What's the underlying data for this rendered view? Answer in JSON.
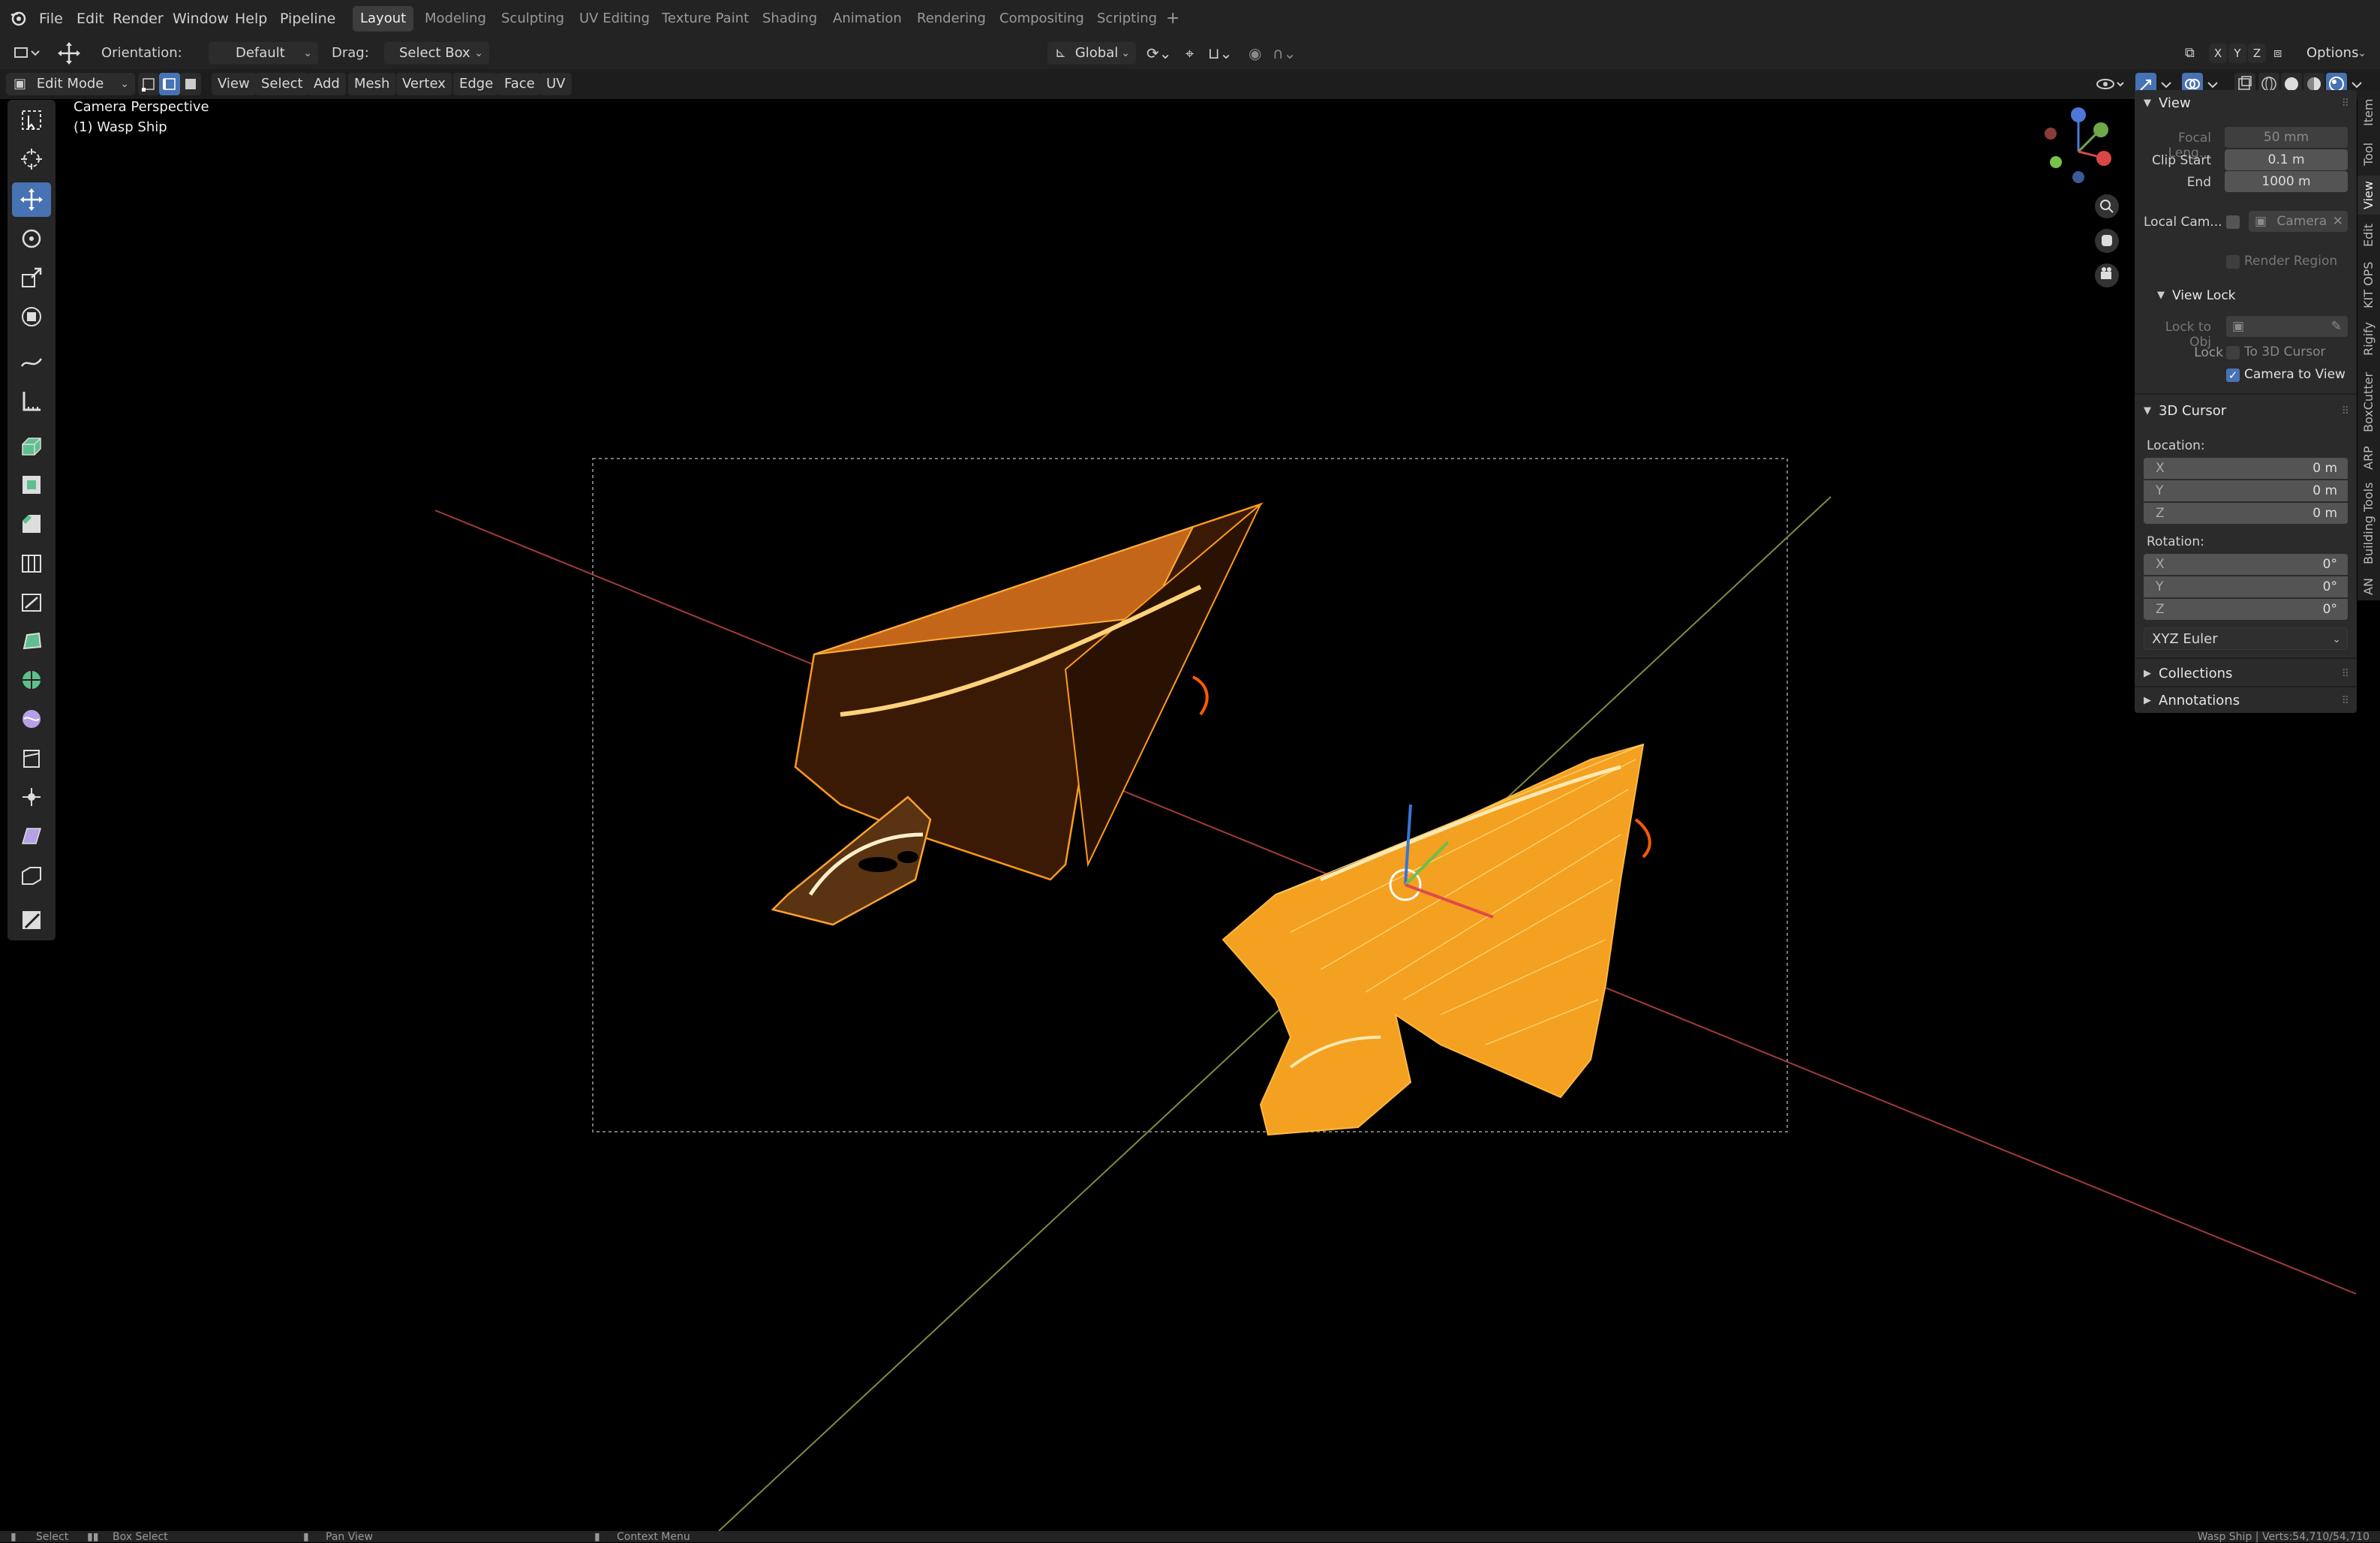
{
  "menubar": {
    "items": [
      "File",
      "Edit",
      "Render",
      "Window",
      "Help",
      "Pipeline"
    ],
    "workspaces": [
      {
        "label": "Layout",
        "active": true
      },
      {
        "label": "Modeling",
        "active": false
      },
      {
        "label": "Sculpting",
        "active": false
      },
      {
        "label": "UV Editing",
        "active": false
      },
      {
        "label": "Texture Paint",
        "active": false
      },
      {
        "label": "Shading",
        "active": false
      },
      {
        "label": "Animation",
        "active": false
      },
      {
        "label": "Rendering",
        "active": false
      },
      {
        "label": "Compositing",
        "active": false
      },
      {
        "label": "Scripting",
        "active": false
      }
    ],
    "add_tab": "+"
  },
  "toolbar": {
    "orientation_label": "Orientation:",
    "orientation_value": "Default",
    "drag_label": "Drag:",
    "drag_value": "Select Box",
    "transform_orientation": "Global",
    "axis_x": "X",
    "axis_y": "Y",
    "axis_z": "Z",
    "options": "Options"
  },
  "viewport_header": {
    "mode": "Edit Mode",
    "menus": [
      "View",
      "Select",
      "Add",
      "Mesh",
      "Vertex",
      "Edge",
      "Face",
      "UV"
    ]
  },
  "viewport": {
    "camera_label": "Camera Perspective",
    "object_label": "(1) Wasp Ship"
  },
  "sidebar": {
    "view_panel": {
      "title": "View",
      "focal_length_label": "Focal Leng...",
      "focal_length_value": "50 mm",
      "clip_start_label": "Clip Start",
      "clip_start_value": "0.1 m",
      "end_label": "End",
      "end_value": "1000 m",
      "local_camera_label": "Local Cam...",
      "local_camera_value": "Camera",
      "render_region_label": "Render Region",
      "view_lock_title": "View Lock",
      "lock_to_obj_label": "Lock to Obj",
      "lock_label": "Lock",
      "to_3d_cursor_label": "To 3D Cursor",
      "camera_to_view_label": "Camera to View",
      "camera_to_view_checked": true
    },
    "cursor_panel": {
      "title": "3D Cursor",
      "location_label": "Location:",
      "location": [
        {
          "axis": "X",
          "value": "0 m"
        },
        {
          "axis": "Y",
          "value": "0 m"
        },
        {
          "axis": "Z",
          "value": "0 m"
        }
      ],
      "rotation_label": "Rotation:",
      "rotation": [
        {
          "axis": "X",
          "value": "0°"
        },
        {
          "axis": "Y",
          "value": "0°"
        },
        {
          "axis": "Z",
          "value": "0°"
        }
      ],
      "rotation_mode": "XYZ Euler"
    },
    "collections_title": "Collections",
    "annotations_title": "Annotations",
    "tabs": [
      "Item",
      "Tool",
      "View",
      "Edit",
      "KIT OPS",
      "Rigify",
      "BoxCutter",
      "ARP",
      "Building Tools",
      "AN"
    ],
    "active_tab": "View"
  },
  "statusbar": {
    "select": "Select",
    "box_select": "Box Select",
    "pan_view": "Pan View",
    "context_menu": "Context Menu",
    "stats": "Wasp Ship | Verts:54,710/54,710"
  },
  "colors": {
    "accent": "#4772b3",
    "panel": "#2b2b2b",
    "header": "#232323",
    "mesh_orange": "#ffa31a",
    "axis_x": "#c0392b",
    "axis_y": "#8fae3c"
  }
}
